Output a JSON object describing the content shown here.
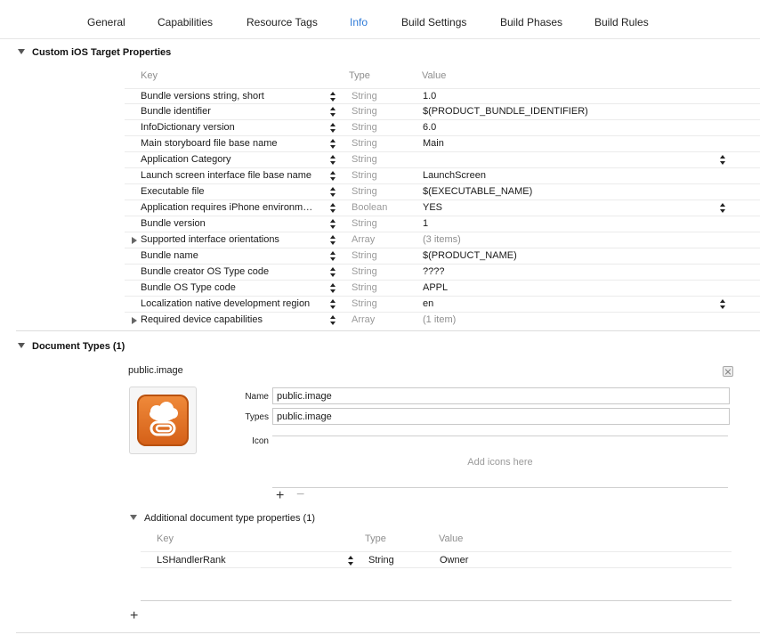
{
  "tabs": [
    {
      "label": "General"
    },
    {
      "label": "Capabilities"
    },
    {
      "label": "Resource Tags"
    },
    {
      "label": "Info"
    },
    {
      "label": "Build Settings"
    },
    {
      "label": "Build Phases"
    },
    {
      "label": "Build Rules"
    }
  ],
  "active_tab": "Info",
  "accent_color": "#2f7bd8",
  "custom_properties": {
    "title": "Custom iOS Target Properties",
    "columns": {
      "key": "Key",
      "type": "Type",
      "value": "Value"
    },
    "rows": [
      {
        "key": "Bundle versions string, short",
        "type": "String",
        "value": "1.0"
      },
      {
        "key": "Bundle identifier",
        "type": "String",
        "value": "$(PRODUCT_BUNDLE_IDENTIFIER)"
      },
      {
        "key": "InfoDictionary version",
        "type": "String",
        "value": "6.0"
      },
      {
        "key": "Main storyboard file base name",
        "type": "String",
        "value": "Main"
      },
      {
        "key": "Application Category",
        "type": "String",
        "value": ""
      },
      {
        "key": "Launch screen interface file base name",
        "type": "String",
        "value": "LaunchScreen"
      },
      {
        "key": "Executable file",
        "type": "String",
        "value": "$(EXECUTABLE_NAME)"
      },
      {
        "key": "Application requires iPhone environm…",
        "type": "Boolean",
        "value": "YES"
      },
      {
        "key": "Bundle version",
        "type": "String",
        "value": "1"
      },
      {
        "key": "Supported interface orientations",
        "type": "Array",
        "value": "(3 items)"
      },
      {
        "key": "Bundle name",
        "type": "String",
        "value": "$(PRODUCT_NAME)"
      },
      {
        "key": "Bundle creator OS Type code",
        "type": "String",
        "value": "????"
      },
      {
        "key": "Bundle OS Type code",
        "type": "String",
        "value": "APPL"
      },
      {
        "key": "Localization native development region",
        "type": "String",
        "value": "en"
      },
      {
        "key": "Required device capabilities",
        "type": "Array",
        "value": "(1 item)"
      }
    ]
  },
  "document_types": {
    "title": "Document Types (1)",
    "item_title": "public.image",
    "icon": "cloud-paperclip-app-icon",
    "name_label": "Name",
    "name_value": "public.image",
    "types_label": "Types",
    "types_value": "public.image",
    "icon_label": "Icon",
    "icons_placeholder": "Add icons here",
    "add_symbol": "+",
    "remove_symbol": "−",
    "additional": {
      "title": "Additional document type properties (1)",
      "columns": {
        "key": "Key",
        "type": "Type",
        "value": "Value"
      },
      "rows": [
        {
          "key": "LSHandlerRank",
          "type": "String",
          "value": "Owner"
        }
      ]
    },
    "add_document_symbol": "+"
  }
}
